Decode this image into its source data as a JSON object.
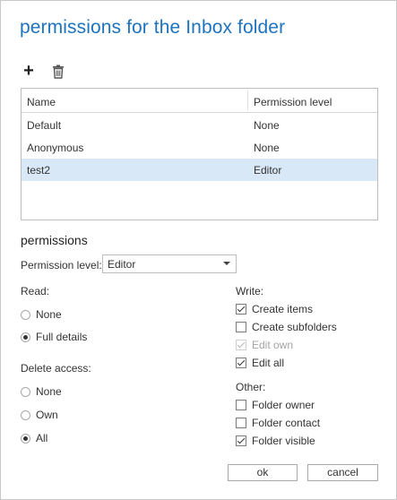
{
  "dialog": {
    "title": "permissions for the Inbox folder"
  },
  "toolbar": {
    "add_icon": "plus-icon",
    "delete_icon": "trash-icon"
  },
  "grid": {
    "columns": [
      "Name",
      "Permission level"
    ],
    "rows": [
      {
        "name": "Default",
        "level": "None",
        "selected": false
      },
      {
        "name": "Anonymous",
        "level": "None",
        "selected": false
      },
      {
        "name": "test2",
        "level": "Editor",
        "selected": true
      }
    ]
  },
  "permissions": {
    "section_title": "permissions",
    "level_label": "Permission level:",
    "level_value": "Editor",
    "read": {
      "label": "Read:",
      "options": [
        {
          "label": "None",
          "checked": false
        },
        {
          "label": "Full details",
          "checked": true
        }
      ]
    },
    "delete_access": {
      "label": "Delete access:",
      "options": [
        {
          "label": "None",
          "checked": false
        },
        {
          "label": "Own",
          "checked": false
        },
        {
          "label": "All",
          "checked": true
        }
      ]
    },
    "write": {
      "label": "Write:",
      "options": [
        {
          "label": "Create items",
          "checked": true,
          "disabled": false
        },
        {
          "label": "Create subfolders",
          "checked": false,
          "disabled": false
        },
        {
          "label": "Edit own",
          "checked": true,
          "disabled": true
        },
        {
          "label": "Edit all",
          "checked": true,
          "disabled": false
        }
      ]
    },
    "other": {
      "label": "Other:",
      "options": [
        {
          "label": "Folder owner",
          "checked": false
        },
        {
          "label": "Folder contact",
          "checked": false
        },
        {
          "label": "Folder visible",
          "checked": true
        }
      ]
    }
  },
  "buttons": {
    "ok": "ok",
    "cancel": "cancel"
  },
  "colors": {
    "title": "#1e73be",
    "selected_row": "#d9e8f6",
    "border": "#bdbdbd"
  }
}
